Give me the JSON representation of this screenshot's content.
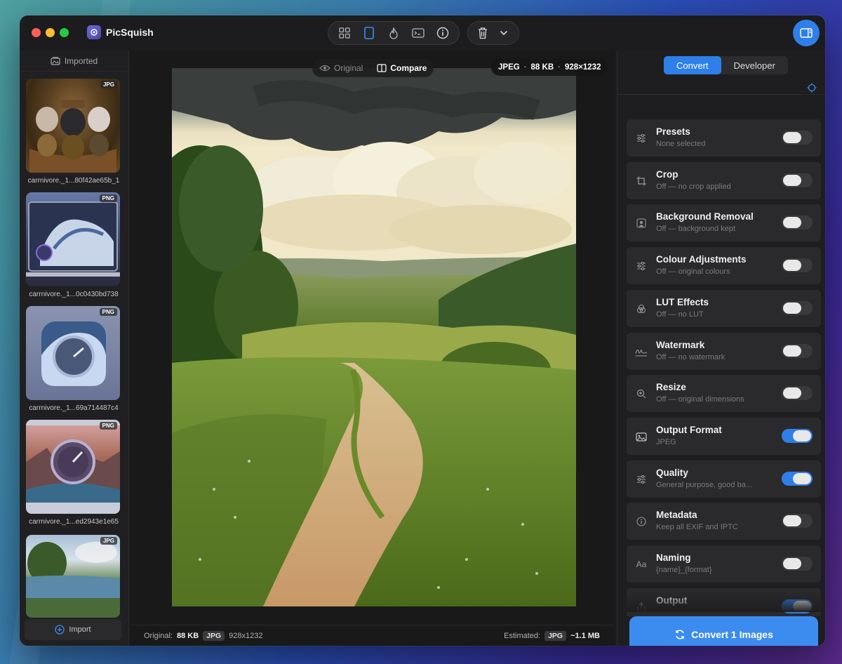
{
  "app": {
    "name": "PicSquish"
  },
  "toolbar": {
    "icons": [
      "grid-icon",
      "single-view-icon",
      "flame-icon",
      "terminal-icon",
      "info-icon",
      "trash-icon",
      "chevron-down-icon"
    ]
  },
  "left": {
    "header": "Imported",
    "items": [
      {
        "name": "carrnivore._1...80f42ae65b_1",
        "badge": "JPG"
      },
      {
        "name": "carrnivore._1...0c0430bd738",
        "badge": "PNG"
      },
      {
        "name": "carrnivore._1...69a714487c4",
        "badge": "PNG"
      },
      {
        "name": "carrnivore._1...ed2943e1e65",
        "badge": "PNG"
      },
      {
        "name": "",
        "badge": "JPG"
      }
    ],
    "import_label": "Import"
  },
  "preview": {
    "original_label": "Original",
    "compare_label": "Compare",
    "meta_format": "JPEG",
    "meta_size": "88 KB",
    "meta_dims": "928×1232"
  },
  "status": {
    "original_label": "Original:",
    "original_size": "88 KB",
    "original_format": "JPG",
    "original_dims": "928x1232",
    "estimated_label": "Estimated:",
    "estimated_format": "JPG",
    "estimated_size": "~1.1 MB"
  },
  "right": {
    "tabs": [
      "Convert",
      "Developer"
    ],
    "active_tab": "Convert",
    "settings": [
      {
        "title": "Presets",
        "sub": "None selected",
        "on": false,
        "icon": "sliders-icon"
      },
      {
        "title": "Crop",
        "sub": "Off — no crop applied",
        "on": false,
        "icon": "crop-icon"
      },
      {
        "title": "Background Removal",
        "sub": "Off — background kept",
        "on": false,
        "icon": "person-icon"
      },
      {
        "title": "Colour Adjustments",
        "sub": "Off — original colours",
        "on": false,
        "icon": "sliders-icon"
      },
      {
        "title": "LUT Effects",
        "sub": "Off — no LUT",
        "on": false,
        "icon": "lut-icon"
      },
      {
        "title": "Watermark",
        "sub": "Off — no watermark",
        "on": false,
        "icon": "signature-icon"
      },
      {
        "title": "Resize",
        "sub": "Off — original dimensions",
        "on": false,
        "icon": "zoom-icon"
      },
      {
        "title": "Output Format",
        "sub": "JPEG",
        "on": true,
        "icon": "photo-icon"
      },
      {
        "title": "Quality",
        "sub": "General purpose, good ba...",
        "on": true,
        "icon": "sliders-icon"
      },
      {
        "title": "Metadata",
        "sub": "Keep all EXIF and IPTC",
        "on": false,
        "icon": "info-icon"
      },
      {
        "title": "Naming",
        "sub": "{name}_{format}",
        "on": false,
        "icon": "text-aa-icon"
      },
      {
        "title": "Output",
        "sub": "",
        "on": true,
        "icon": "share-icon"
      }
    ],
    "convert_label": "Convert 1 Images"
  },
  "colors": {
    "accent": "#2f7fe8",
    "window_bg": "#1c1c1e"
  }
}
